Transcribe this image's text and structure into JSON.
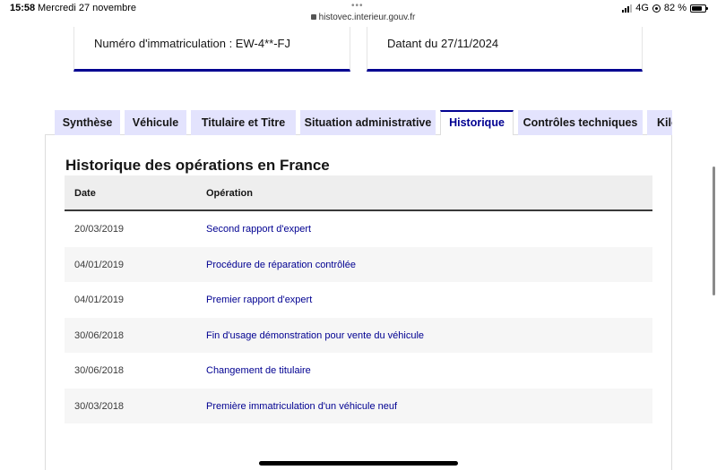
{
  "status_bar": {
    "time": "15:58",
    "date": "Mercredi 27 novembre",
    "url": "histovec.interieur.gouv.fr",
    "network": "4G",
    "battery": "82 %",
    "battery_level": 0.82
  },
  "cards": {
    "registration": "Numéro d'immatriculation : EW-4**-FJ",
    "dated": "Datant du 27/11/2024"
  },
  "tabs": [
    {
      "label": "Synthèse"
    },
    {
      "label": "Véhicule"
    },
    {
      "label": "Titulaire et Titre"
    },
    {
      "label": "Situation administrative"
    },
    {
      "label": "Historique",
      "active": true
    },
    {
      "label": "Contrôles techniques"
    },
    {
      "label": "Kilo"
    }
  ],
  "section": {
    "title": "Historique des opérations en France"
  },
  "table": {
    "headers": {
      "date": "Date",
      "operation": "Opération"
    },
    "rows": [
      {
        "date": "20/03/2019",
        "operation": "Second rapport d'expert"
      },
      {
        "date": "04/01/2019",
        "operation": "Procédure de réparation contrôlée"
      },
      {
        "date": "04/01/2019",
        "operation": "Premier rapport d'expert"
      },
      {
        "date": "30/06/2018",
        "operation": "Fin d'usage démonstration pour vente du véhicule"
      },
      {
        "date": "30/06/2018",
        "operation": "Changement de titulaire"
      },
      {
        "date": "30/03/2018",
        "operation": "Première immatriculation d'un véhicule neuf"
      }
    ]
  },
  "colors": {
    "accent": "#000091",
    "tab_bg": "#e3e3fd",
    "header_bg": "#eeeeee"
  }
}
